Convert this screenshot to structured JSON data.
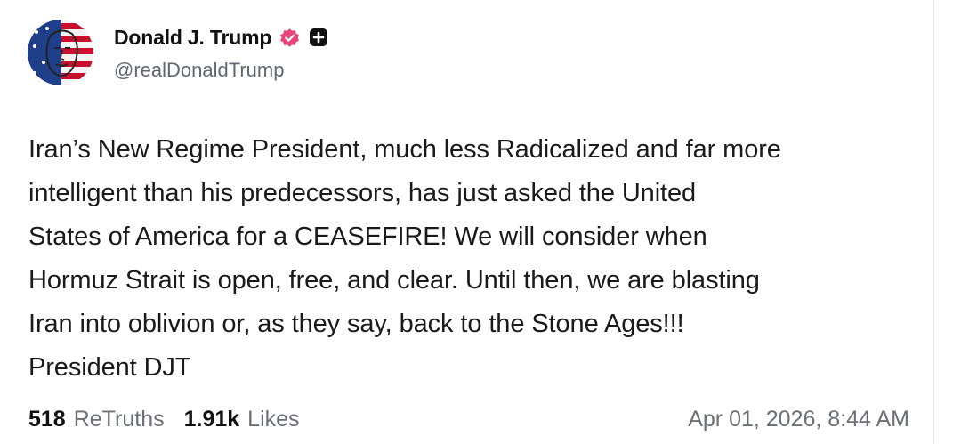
{
  "author": {
    "display_name": "Donald J. Trump",
    "handle": "@realDonaldTrump"
  },
  "badges": {
    "verified_icon": "verified-badge-icon",
    "verified_color": "#e8457c",
    "plus_icon": "plus-square-icon"
  },
  "post": {
    "text": "Iran’s New Regime President, much less Radicalized and far more\nintelligent than his predecessors, has just asked the United\nStates of America for a CEASEFIRE! We will consider when\nHormuz Strait is open, free, and clear. Until then, we are blasting\nIran into oblivion or, as they say, back to the Stone Ages!!!\nPresident DJT"
  },
  "stats": {
    "retruths_count": "518",
    "retruths_label": "ReTruths",
    "likes_count": "1.91k",
    "likes_label": "Likes"
  },
  "timestamp": "Apr 01, 2026, 8:44 AM"
}
